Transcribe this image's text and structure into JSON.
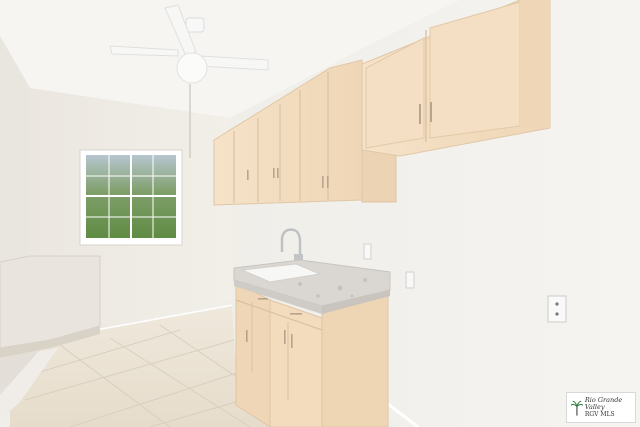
{
  "photo": {
    "subject": "kitchenette",
    "elements": [
      "ceiling-fan",
      "window",
      "upper-cabinets",
      "lower-cabinets",
      "sink",
      "granite-countertop",
      "faucet",
      "wall-outlet",
      "peninsula-countertop",
      "tile-floor"
    ],
    "colors": {
      "wall": "#f1efea",
      "ceiling": "#f6f5f2",
      "cabinet": "#f3dcc0",
      "cabinet_shadow": "#e2c8a8",
      "counter": "#d9d6d2",
      "floor": "#ece4d7",
      "window_foliage": "#6f9a52"
    }
  },
  "watermark": {
    "line1": "Rio Grande Valley",
    "line2": "RGV MLS"
  }
}
